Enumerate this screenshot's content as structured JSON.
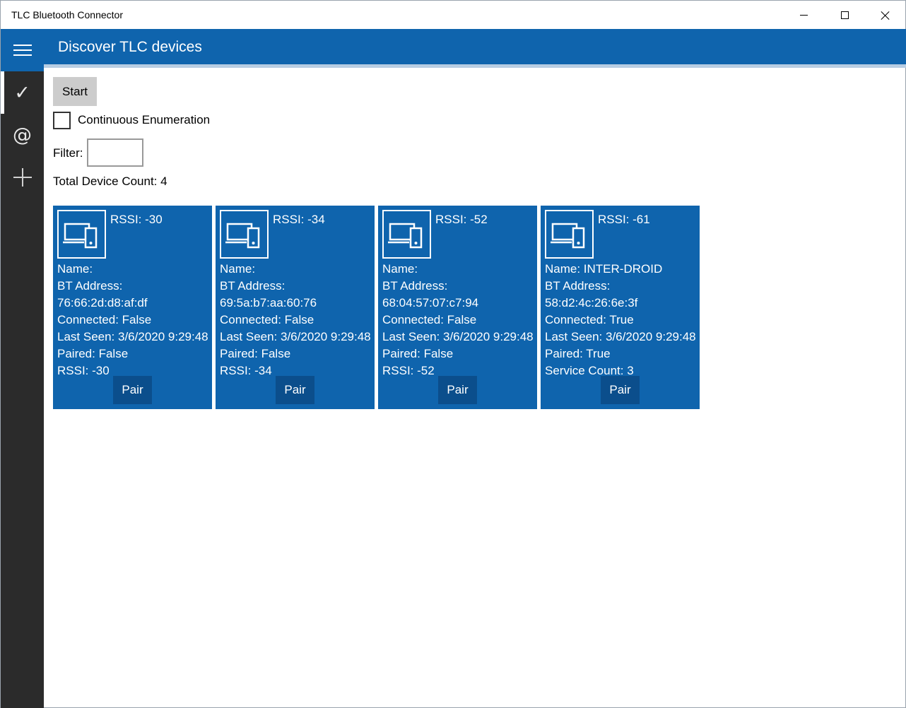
{
  "window": {
    "title": "TLC Bluetooth Connector"
  },
  "header": {
    "title": "Discover TLC devices"
  },
  "sidebar": {
    "items": [
      {
        "name": "check",
        "glyph": "✓",
        "active": true
      },
      {
        "name": "at",
        "glyph": "@",
        "active": false
      },
      {
        "name": "plus",
        "glyph": "+",
        "active": false
      }
    ]
  },
  "controls": {
    "start_label": "Start",
    "continuous_label": "Continuous Enumeration",
    "continuous_checked": false,
    "filter_label": "Filter:",
    "filter_value": "",
    "count_text": "Total Device Count: 4"
  },
  "devices": [
    {
      "rssi_header": "RSSI: -30",
      "lines": [
        "Name:",
        "BT Address:",
        "76:66:2d:d8:af:df",
        "Connected: False",
        "Last Seen: 3/6/2020 9:29:48",
        "Paired: False",
        "RSSI: -30"
      ],
      "pair_label": "Pair"
    },
    {
      "rssi_header": "RSSI: -34",
      "lines": [
        "Name:",
        "BT Address:",
        "69:5a:b7:aa:60:76",
        "Connected: False",
        "Last Seen: 3/6/2020 9:29:48",
        "Paired: False",
        "RSSI: -34"
      ],
      "pair_label": "Pair"
    },
    {
      "rssi_header": "RSSI: -52",
      "lines": [
        "Name:",
        "BT Address:",
        "68:04:57:07:c7:94",
        "Connected: False",
        "Last Seen: 3/6/2020 9:29:48",
        "Paired: False",
        "RSSI: -52"
      ],
      "pair_label": "Pair"
    },
    {
      "rssi_header": "RSSI: -61",
      "lines": [
        "Name: INTER-DROID",
        "BT Address:",
        "58:d2:4c:26:6e:3f",
        "Connected: True",
        "Last Seen: 3/6/2020 9:29:48",
        "Paired: True",
        "Service Count: 3"
      ],
      "pair_label": "Pair"
    }
  ],
  "colors": {
    "accent": "#0f64ad",
    "sidebar": "#2b2b2b",
    "pair_button": "#0b4e8c"
  }
}
